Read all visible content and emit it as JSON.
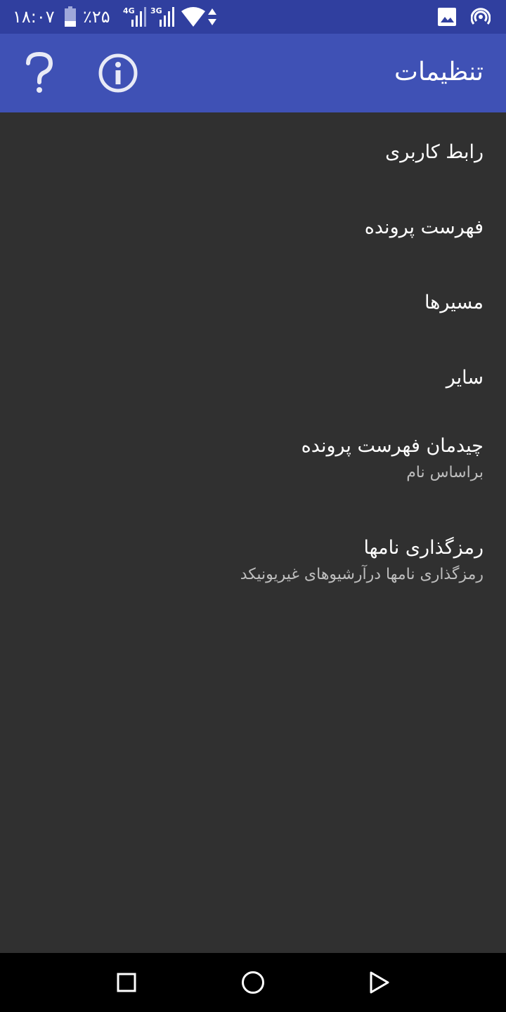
{
  "status_bar": {
    "time": "۱۸:۰۷",
    "battery": "٪۲۵",
    "network_1": "4G",
    "network_2": "3G"
  },
  "app_bar": {
    "title": "تنظیمات"
  },
  "settings": [
    {
      "title": "رابط کاربری"
    },
    {
      "title": "فهرست پرونده"
    },
    {
      "title": "مسیرها"
    },
    {
      "title": "سایر"
    },
    {
      "title": "چیدمان فهرست پرونده",
      "summary": "براساس نام"
    },
    {
      "title": "رمزگذاری نامها",
      "summary": "رمزگذاری نامها درآرشیوهای غیریونیکد"
    }
  ],
  "colors": {
    "status_bar": "#303f9f",
    "app_bar": "#3f51b5",
    "background": "#303030",
    "nav_bar": "#000000"
  }
}
